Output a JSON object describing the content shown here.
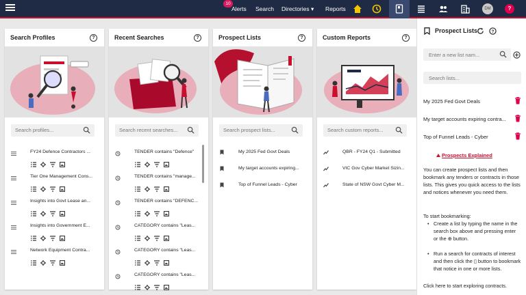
{
  "nav": {
    "alerts_badge": "10",
    "alerts": "Alerts",
    "search": "Search",
    "directories": "Directories",
    "reports": "Reports",
    "avatar_initials": "DM",
    "help_glyph": "?"
  },
  "cards": [
    {
      "title": "Search Profiles",
      "placeholder": "Search profiles...",
      "items": [
        "FY24 Defence Contractors ...",
        "Tier One Management Cons...",
        "Insights into Govt Lease an...",
        "Insights into Government E...",
        "Network Equipment Contra..."
      ]
    },
    {
      "title": "Recent Searches",
      "placeholder": "Search recent searches...",
      "items": [
        "TENDER contains \"Defence\"",
        "TENDER contains \"manage...",
        "TENDER contains \"DEFENC...",
        "CATEGORY contains \"Leas...",
        "CATEGORY contains \"Leas...",
        "CATEGORY contains \"Leas..."
      ]
    },
    {
      "title": "Prospect Lists",
      "placeholder": "Search prospect lists...",
      "items": [
        "My 2025 Fed Govt Deals",
        "My target accounts expiring...",
        "Top of Funnel Leads - Cyber"
      ]
    },
    {
      "title": "Custom Reports",
      "placeholder": "Search custom reports...",
      "items": [
        "QBR - FY24 Q1 - Submitted",
        "VIC Gov Cyber Market Sizin...",
        "State of NSW Govt Cyber M..."
      ]
    }
  ],
  "panel": {
    "title": "Prospect Lists",
    "new_list_placeholder": "Enter a new list nam...",
    "search_placeholder": "Search lists...",
    "lists": [
      "My 2025 Fed Govt Deals",
      "My target accounts expiring contra...",
      "Top of Funnel Leads - Cyber"
    ],
    "explained_label": "Prospects Explained",
    "intro": "You can create prospect lists and then bookmark any tenders or contracts in those lists. This gives you quick access to the lists and notices whenever you need them.",
    "start_heading": "To start bookmarking:",
    "step1": "Create a list by typing the name in the search box above and pressing enter or the ⊕ button.",
    "step2": "Run a search for contracts of interest and then click the ▯ button to bookmark that notice in one or more lists.",
    "footer": "Click here to start exploring contracts."
  },
  "colors": {
    "accent": "#c8102e",
    "navbar": "#1f2a44",
    "delete": "#e0004d"
  }
}
